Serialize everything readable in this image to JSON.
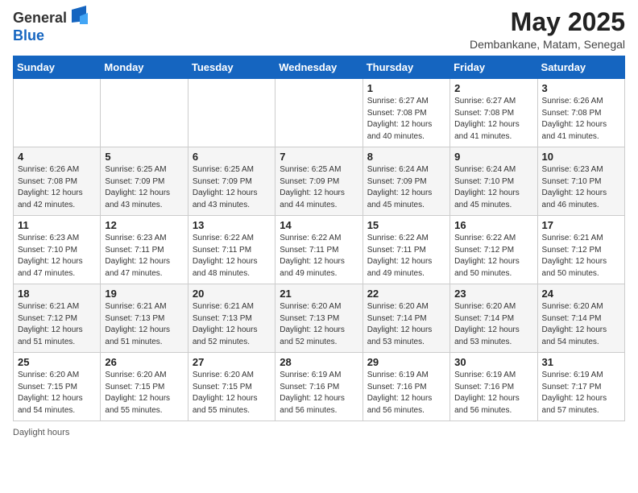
{
  "header": {
    "logo_general": "General",
    "logo_blue": "Blue",
    "title": "May 2025",
    "subtitle": "Dembankane, Matam, Senegal"
  },
  "days_of_week": [
    "Sunday",
    "Monday",
    "Tuesday",
    "Wednesday",
    "Thursday",
    "Friday",
    "Saturday"
  ],
  "weeks": [
    [
      {
        "day": "",
        "sunrise": "",
        "sunset": "",
        "daylight": ""
      },
      {
        "day": "",
        "sunrise": "",
        "sunset": "",
        "daylight": ""
      },
      {
        "day": "",
        "sunrise": "",
        "sunset": "",
        "daylight": ""
      },
      {
        "day": "",
        "sunrise": "",
        "sunset": "",
        "daylight": ""
      },
      {
        "day": "1",
        "sunrise": "Sunrise: 6:27 AM",
        "sunset": "Sunset: 7:08 PM",
        "daylight": "Daylight: 12 hours and 40 minutes."
      },
      {
        "day": "2",
        "sunrise": "Sunrise: 6:27 AM",
        "sunset": "Sunset: 7:08 PM",
        "daylight": "Daylight: 12 hours and 41 minutes."
      },
      {
        "day": "3",
        "sunrise": "Sunrise: 6:26 AM",
        "sunset": "Sunset: 7:08 PM",
        "daylight": "Daylight: 12 hours and 41 minutes."
      }
    ],
    [
      {
        "day": "4",
        "sunrise": "Sunrise: 6:26 AM",
        "sunset": "Sunset: 7:08 PM",
        "daylight": "Daylight: 12 hours and 42 minutes."
      },
      {
        "day": "5",
        "sunrise": "Sunrise: 6:25 AM",
        "sunset": "Sunset: 7:09 PM",
        "daylight": "Daylight: 12 hours and 43 minutes."
      },
      {
        "day": "6",
        "sunrise": "Sunrise: 6:25 AM",
        "sunset": "Sunset: 7:09 PM",
        "daylight": "Daylight: 12 hours and 43 minutes."
      },
      {
        "day": "7",
        "sunrise": "Sunrise: 6:25 AM",
        "sunset": "Sunset: 7:09 PM",
        "daylight": "Daylight: 12 hours and 44 minutes."
      },
      {
        "day": "8",
        "sunrise": "Sunrise: 6:24 AM",
        "sunset": "Sunset: 7:09 PM",
        "daylight": "Daylight: 12 hours and 45 minutes."
      },
      {
        "day": "9",
        "sunrise": "Sunrise: 6:24 AM",
        "sunset": "Sunset: 7:10 PM",
        "daylight": "Daylight: 12 hours and 45 minutes."
      },
      {
        "day": "10",
        "sunrise": "Sunrise: 6:23 AM",
        "sunset": "Sunset: 7:10 PM",
        "daylight": "Daylight: 12 hours and 46 minutes."
      }
    ],
    [
      {
        "day": "11",
        "sunrise": "Sunrise: 6:23 AM",
        "sunset": "Sunset: 7:10 PM",
        "daylight": "Daylight: 12 hours and 47 minutes."
      },
      {
        "day": "12",
        "sunrise": "Sunrise: 6:23 AM",
        "sunset": "Sunset: 7:11 PM",
        "daylight": "Daylight: 12 hours and 47 minutes."
      },
      {
        "day": "13",
        "sunrise": "Sunrise: 6:22 AM",
        "sunset": "Sunset: 7:11 PM",
        "daylight": "Daylight: 12 hours and 48 minutes."
      },
      {
        "day": "14",
        "sunrise": "Sunrise: 6:22 AM",
        "sunset": "Sunset: 7:11 PM",
        "daylight": "Daylight: 12 hours and 49 minutes."
      },
      {
        "day": "15",
        "sunrise": "Sunrise: 6:22 AM",
        "sunset": "Sunset: 7:11 PM",
        "daylight": "Daylight: 12 hours and 49 minutes."
      },
      {
        "day": "16",
        "sunrise": "Sunrise: 6:22 AM",
        "sunset": "Sunset: 7:12 PM",
        "daylight": "Daylight: 12 hours and 50 minutes."
      },
      {
        "day": "17",
        "sunrise": "Sunrise: 6:21 AM",
        "sunset": "Sunset: 7:12 PM",
        "daylight": "Daylight: 12 hours and 50 minutes."
      }
    ],
    [
      {
        "day": "18",
        "sunrise": "Sunrise: 6:21 AM",
        "sunset": "Sunset: 7:12 PM",
        "daylight": "Daylight: 12 hours and 51 minutes."
      },
      {
        "day": "19",
        "sunrise": "Sunrise: 6:21 AM",
        "sunset": "Sunset: 7:13 PM",
        "daylight": "Daylight: 12 hours and 51 minutes."
      },
      {
        "day": "20",
        "sunrise": "Sunrise: 6:21 AM",
        "sunset": "Sunset: 7:13 PM",
        "daylight": "Daylight: 12 hours and 52 minutes."
      },
      {
        "day": "21",
        "sunrise": "Sunrise: 6:20 AM",
        "sunset": "Sunset: 7:13 PM",
        "daylight": "Daylight: 12 hours and 52 minutes."
      },
      {
        "day": "22",
        "sunrise": "Sunrise: 6:20 AM",
        "sunset": "Sunset: 7:14 PM",
        "daylight": "Daylight: 12 hours and 53 minutes."
      },
      {
        "day": "23",
        "sunrise": "Sunrise: 6:20 AM",
        "sunset": "Sunset: 7:14 PM",
        "daylight": "Daylight: 12 hours and 53 minutes."
      },
      {
        "day": "24",
        "sunrise": "Sunrise: 6:20 AM",
        "sunset": "Sunset: 7:14 PM",
        "daylight": "Daylight: 12 hours and 54 minutes."
      }
    ],
    [
      {
        "day": "25",
        "sunrise": "Sunrise: 6:20 AM",
        "sunset": "Sunset: 7:15 PM",
        "daylight": "Daylight: 12 hours and 54 minutes."
      },
      {
        "day": "26",
        "sunrise": "Sunrise: 6:20 AM",
        "sunset": "Sunset: 7:15 PM",
        "daylight": "Daylight: 12 hours and 55 minutes."
      },
      {
        "day": "27",
        "sunrise": "Sunrise: 6:20 AM",
        "sunset": "Sunset: 7:15 PM",
        "daylight": "Daylight: 12 hours and 55 minutes."
      },
      {
        "day": "28",
        "sunrise": "Sunrise: 6:19 AM",
        "sunset": "Sunset: 7:16 PM",
        "daylight": "Daylight: 12 hours and 56 minutes."
      },
      {
        "day": "29",
        "sunrise": "Sunrise: 6:19 AM",
        "sunset": "Sunset: 7:16 PM",
        "daylight": "Daylight: 12 hours and 56 minutes."
      },
      {
        "day": "30",
        "sunrise": "Sunrise: 6:19 AM",
        "sunset": "Sunset: 7:16 PM",
        "daylight": "Daylight: 12 hours and 56 minutes."
      },
      {
        "day": "31",
        "sunrise": "Sunrise: 6:19 AM",
        "sunset": "Sunset: 7:17 PM",
        "daylight": "Daylight: 12 hours and 57 minutes."
      }
    ]
  ],
  "footer": {
    "daylight_label": "Daylight hours"
  }
}
